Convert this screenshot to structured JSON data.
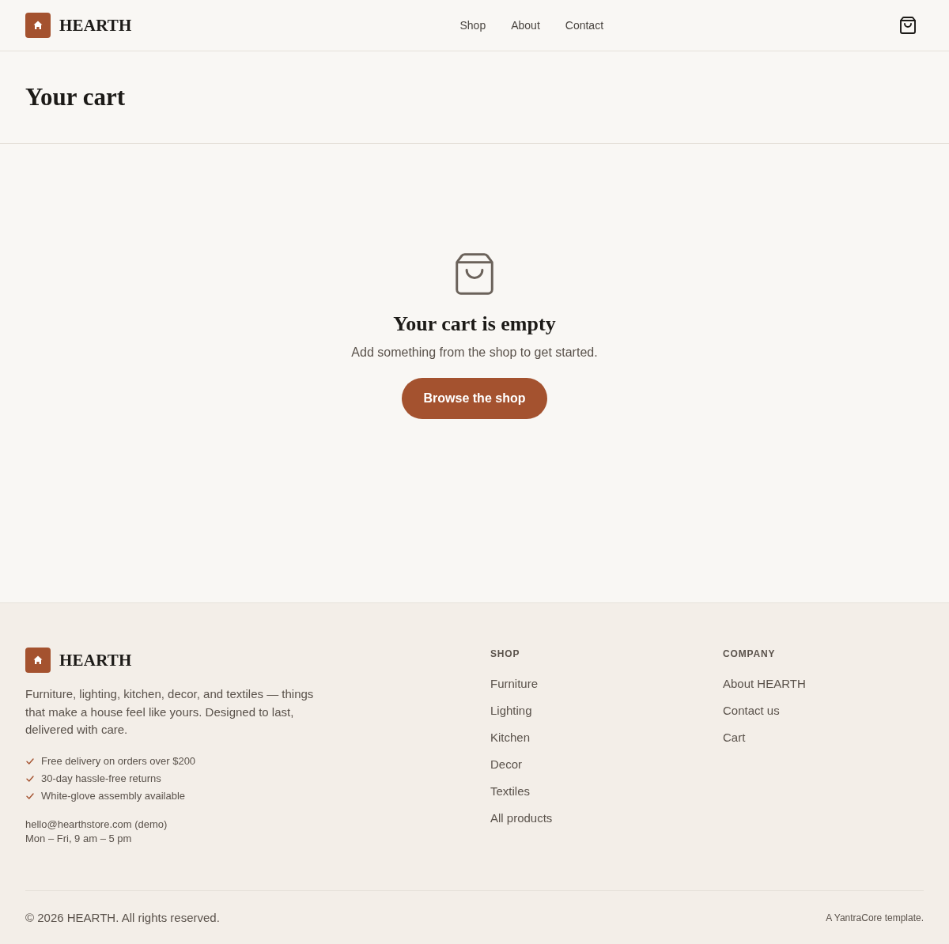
{
  "header": {
    "brand": "HEARTH",
    "nav": [
      "Shop",
      "About",
      "Contact"
    ]
  },
  "page_title": "Your cart",
  "empty_state": {
    "title": "Your cart is empty",
    "message": "Add something from the shop to get started.",
    "button": "Browse the shop"
  },
  "footer": {
    "brand": "HEARTH",
    "description": "Furniture, lighting, kitchen, decor, and textiles — things that make a house feel like yours. Designed to last, delivered with care.",
    "perks": [
      "Free delivery on orders over $200",
      "30-day hassle-free returns",
      "White-glove assembly available"
    ],
    "contact": {
      "email": "hello@hearthstore.com (demo)",
      "hours": "Mon – Fri, 9 am – 5 pm"
    },
    "columns": [
      {
        "heading": "SHOP",
        "links": [
          "Furniture",
          "Lighting",
          "Kitchen",
          "Decor",
          "Textiles",
          "All products"
        ]
      },
      {
        "heading": "COMPANY",
        "links": [
          "About HEARTH",
          "Contact us",
          "Cart"
        ]
      }
    ],
    "copyright": "© 2026 HEARTH. All rights reserved.",
    "credit": "A YantraCore template."
  }
}
